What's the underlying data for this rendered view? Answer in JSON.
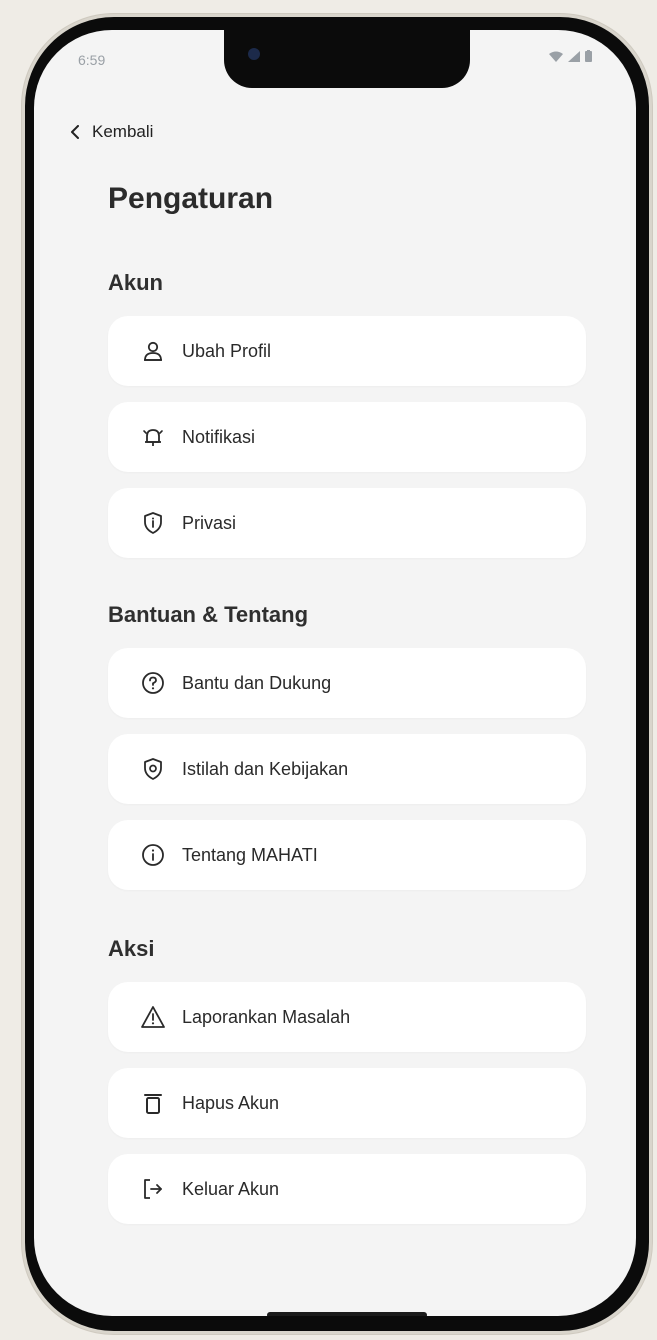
{
  "status_bar": {
    "time": "6:59"
  },
  "nav": {
    "back_label": "Kembali"
  },
  "page": {
    "title": "Pengaturan"
  },
  "sections": [
    {
      "label": "Akun",
      "items": [
        {
          "label": "Ubah Profil",
          "icon": "user-icon"
        },
        {
          "label": "Notifikasi",
          "icon": "bell-icon"
        },
        {
          "label": "Privasi",
          "icon": "shield-icon"
        }
      ]
    },
    {
      "label": "Bantuan & Tentang",
      "items": [
        {
          "label": "Bantu dan Dukung",
          "icon": "help-circle-icon"
        },
        {
          "label": "Istilah dan Kebijakan",
          "icon": "at-sign-icon"
        },
        {
          "label": "Tentang MAHATI",
          "icon": "info-icon"
        }
      ]
    },
    {
      "label": "Aksi",
      "items": [
        {
          "label": "Laporankan Masalah",
          "icon": "warning-icon"
        },
        {
          "label": "Hapus Akun",
          "icon": "trash-icon"
        },
        {
          "label": "Keluar Akun",
          "icon": "logout-icon"
        }
      ]
    }
  ],
  "colors": {
    "screen_bg": "#f4f4f4",
    "card_bg": "#ffffff",
    "text": "#2a2a2a"
  }
}
